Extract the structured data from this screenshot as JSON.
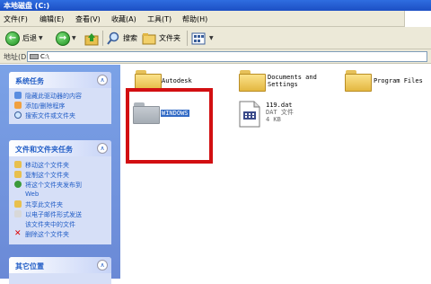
{
  "window": {
    "title": "本地磁盘 (C:)"
  },
  "menu": [
    "文件(F)",
    "编辑(E)",
    "查看(V)",
    "收藏(A)",
    "工具(T)",
    "帮助(H)"
  ],
  "toolbar": {
    "back": "后退",
    "search": "搜索",
    "folders": "文件夹"
  },
  "address": {
    "label": "地址(D)",
    "value": "C:\\"
  },
  "panels": [
    {
      "title": "系统任务",
      "tasks": [
        "隐藏此驱动器的内容",
        "添加/删除程序",
        "搜索文件或文件夹"
      ]
    },
    {
      "title": "文件和文件夹任务",
      "tasks": [
        "移动这个文件夹",
        "复制这个文件夹",
        "将这个文件夹发布到",
        "Web",
        "共享此文件夹",
        "以电子邮件形式发送",
        "该文件夹中的文件",
        "删除这个文件夹"
      ]
    },
    {
      "title": "其它位置",
      "tasks": []
    }
  ],
  "items": [
    {
      "name": "Autodesk",
      "type": "folder"
    },
    {
      "name": "Documents and\nSettings",
      "type": "folder"
    },
    {
      "name": "Program Files",
      "type": "folder"
    },
    {
      "name": "WINDOWS",
      "type": "folder",
      "selected": true
    },
    {
      "name": "119.dat",
      "type": "file",
      "desc": "DAT 文件",
      "size": "4 KB"
    }
  ],
  "colors": {
    "highlight_box": "#d20f12",
    "sidebar": "#7ba2e7",
    "selection": "#316ac5"
  }
}
